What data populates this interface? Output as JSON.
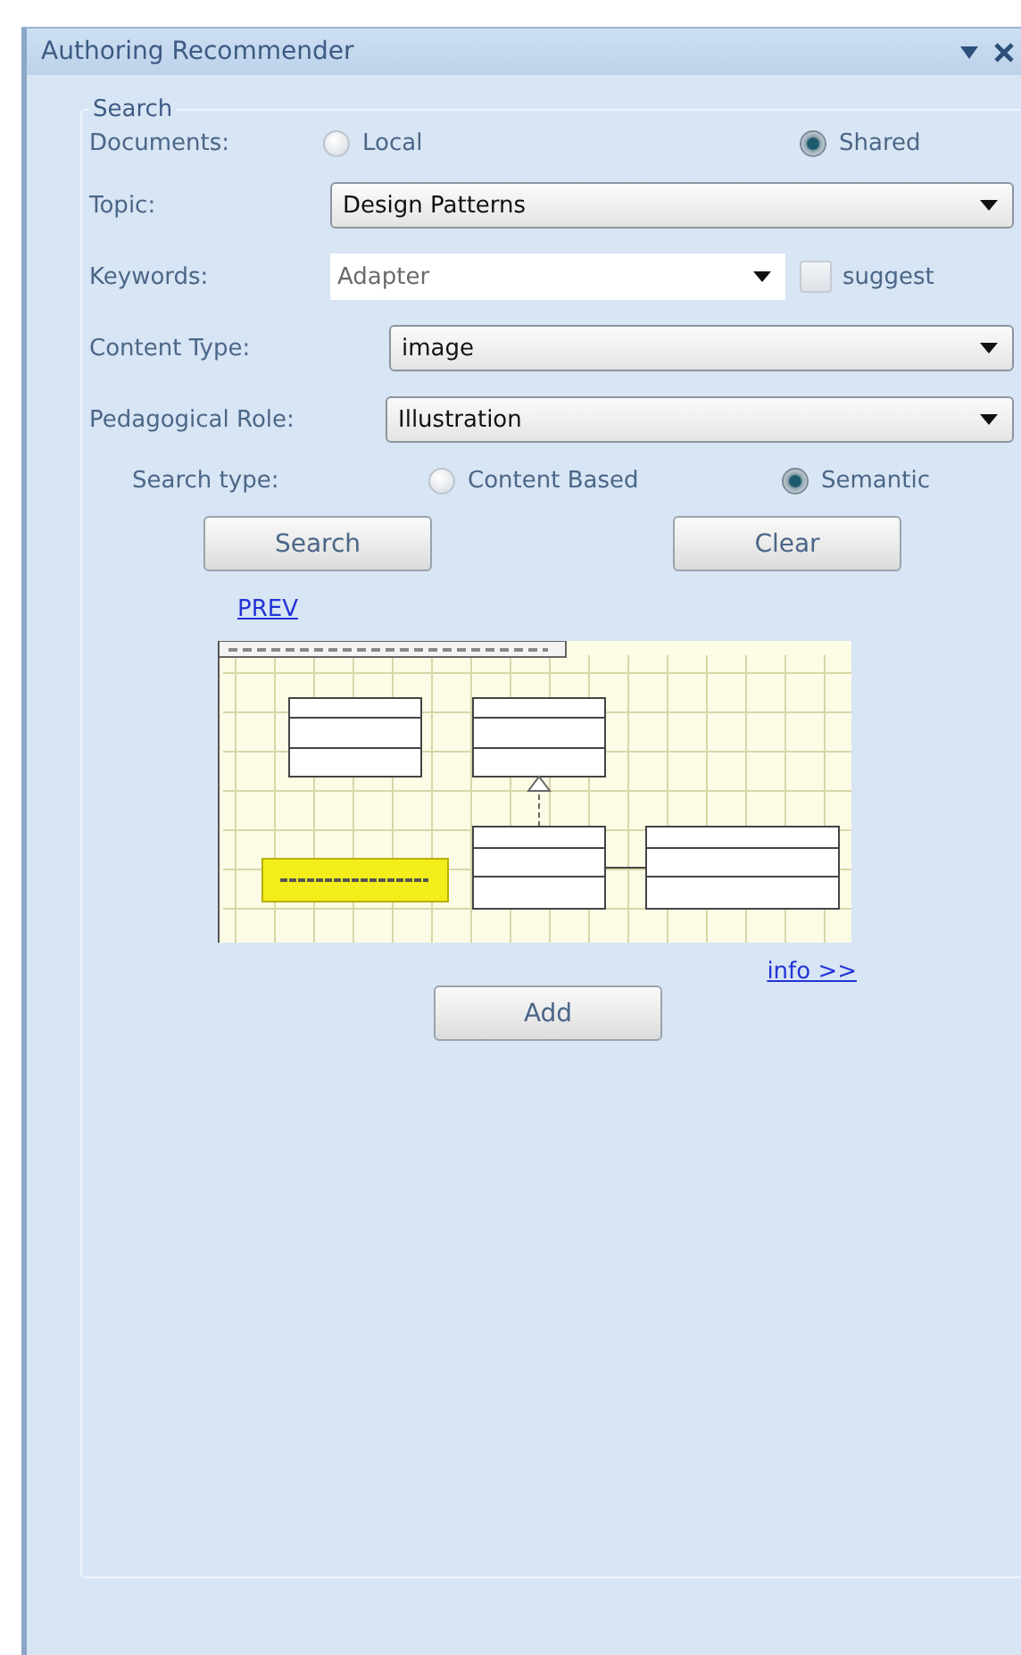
{
  "panel": {
    "title": "Authoring Recommender"
  },
  "search_group": {
    "legend": "Search",
    "documents": {
      "label": "Documents:",
      "options": [
        {
          "label": "Local",
          "selected": false
        },
        {
          "label": "Shared",
          "selected": true
        }
      ]
    },
    "topic": {
      "label": "Topic:",
      "value": "Design Patterns"
    },
    "keywords": {
      "label": "Keywords:",
      "value": "Adapter",
      "suggest": {
        "label": "suggest",
        "checked": false
      }
    },
    "content_type": {
      "label": "Content Type:",
      "value": "image"
    },
    "pedagogical_role": {
      "label": "Pedagogical Role:",
      "value": "Illustration"
    },
    "search_type": {
      "label": "Search type:",
      "options": [
        {
          "label": "Content Based",
          "selected": false
        },
        {
          "label": "Semantic",
          "selected": true
        }
      ]
    },
    "buttons": [
      {
        "label": "Search"
      },
      {
        "label": "Clear"
      }
    ],
    "prev_link": "PREV",
    "info_link": "info >>",
    "add_button": "Add"
  }
}
